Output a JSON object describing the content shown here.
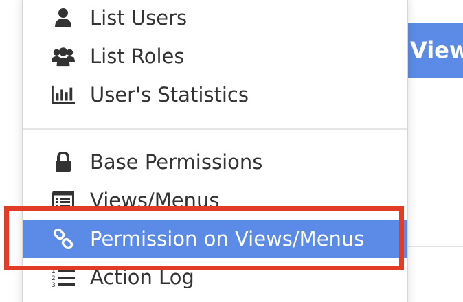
{
  "background": {
    "button_label": "View"
  },
  "menu": {
    "items": [
      {
        "label": "List Users",
        "icon": "user-icon"
      },
      {
        "label": "List Roles",
        "icon": "group-icon"
      },
      {
        "label": "User's Statistics",
        "icon": "bar-chart-icon"
      },
      {
        "label": "Base Permissions",
        "icon": "lock-icon"
      },
      {
        "label": "Views/Menus",
        "icon": "list-alt-icon"
      },
      {
        "label": "Permission on Views/Menus",
        "icon": "link-icon",
        "active": true
      },
      {
        "label": "Action Log",
        "icon": "ordered-list-icon"
      }
    ]
  },
  "colors": {
    "accent": "#5b8be6",
    "highlight": "#e23b26",
    "text": "#333333"
  }
}
